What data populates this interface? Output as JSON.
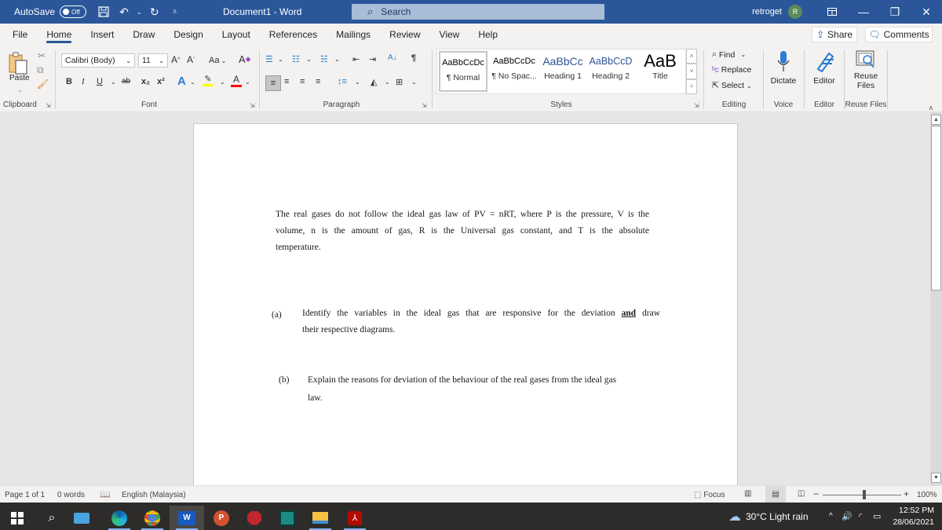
{
  "titlebar": {
    "autosave_label": "AutoSave",
    "autosave_state": "Off",
    "document_title": "Document1  -  Word",
    "search_placeholder": "Search",
    "user_name": "retroget",
    "avatar_initial": "R",
    "icons": [
      "save-icon",
      "undo-icon",
      "redo-icon",
      "customize-qat-icon",
      "ribbon-display-icon",
      "minimize-icon",
      "restore-icon",
      "close-icon"
    ]
  },
  "tabs": [
    {
      "label": "File"
    },
    {
      "label": "Home",
      "active": true
    },
    {
      "label": "Insert"
    },
    {
      "label": "Draw"
    },
    {
      "label": "Design"
    },
    {
      "label": "Layout"
    },
    {
      "label": "References"
    },
    {
      "label": "Mailings"
    },
    {
      "label": "Review"
    },
    {
      "label": "View"
    },
    {
      "label": "Help"
    }
  ],
  "actions": {
    "share_label": "Share",
    "comments_label": "Comments"
  },
  "ribbon": {
    "clipboard": {
      "label": "Clipboard",
      "paste_label": "Paste"
    },
    "font": {
      "label": "Font",
      "font_name": "Calibri (Body)",
      "font_size": "11",
      "change_case": "Aa",
      "bold": "B",
      "italic": "I",
      "underline": "U",
      "strikethrough": "ab",
      "subscript": "x₂",
      "superscript": "x²",
      "highlight_color": "#ffff00",
      "font_color": "#ff0000"
    },
    "paragraph": {
      "label": "Paragraph"
    },
    "styles": {
      "label": "Styles",
      "items": [
        {
          "preview": "AaBbCcDc",
          "name": "¶ Normal",
          "selected": true
        },
        {
          "preview": "AaBbCcDc",
          "name": "¶ No Spac..."
        },
        {
          "preview": "AaBbCc",
          "name": "Heading 1"
        },
        {
          "preview": "AaBbCcD",
          "name": "Heading 2"
        },
        {
          "preview": "AaB",
          "name": "Title"
        }
      ]
    },
    "editing": {
      "label": "Editing",
      "find": "Find",
      "replace": "Replace",
      "select": "Select"
    },
    "voice": {
      "label": "Voice",
      "dictate": "Dictate"
    },
    "editor": {
      "label": "Editor",
      "editor": "Editor"
    },
    "reuse": {
      "label": "Reuse Files",
      "button_line1": "Reuse",
      "button_line2": "Files"
    }
  },
  "document": {
    "intro_lines": [
      "The real gases do not follow the ideal gas law of PV = nRT, where P is the pressure, V is the",
      "volume,  n  is  the  amount  of  gas,  R  is  the  Universal  gas  constant,  and  T  is  the  absolute",
      "temperature."
    ],
    "question_a": {
      "label": "(a)",
      "line1_pre": "Identify the variables in the ideal gas that are responsive for the deviation ",
      "line1_emph": "and",
      "line1_post": " draw",
      "line2": "their respective diagrams."
    },
    "question_b": {
      "label": "(b)",
      "line1": "Explain the reasons for deviation of the behaviour of the real gases from the ideal gas",
      "line2": "law."
    }
  },
  "statusbar": {
    "page": "Page 1 of 1",
    "words": "0 words",
    "language": "English (Malaysia)",
    "focus": "Focus",
    "zoom_minus": "−",
    "zoom_plus": "+",
    "zoom_level": "100%"
  },
  "taskbar": {
    "apps": [
      "start",
      "search",
      "news",
      "edge",
      "chrome",
      "word",
      "powerpoint",
      "app-red",
      "video-editor",
      "file-explorer",
      "acrobat"
    ],
    "weather": "30°C  Light rain",
    "time": "12:52 PM",
    "date": "28/06/2021"
  }
}
